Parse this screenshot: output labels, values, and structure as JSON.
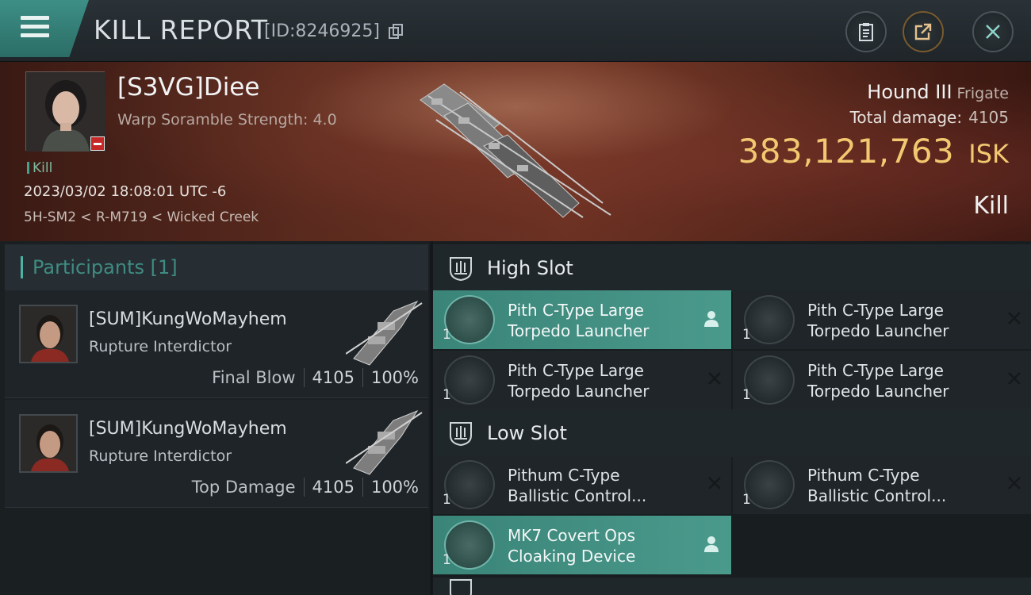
{
  "header": {
    "title": "KILL REPORT",
    "report_id": "[ID:8246925]"
  },
  "victim": {
    "name": "[S3VG]Diee",
    "scramble": "Warp Soramble Strength: 4.0",
    "kill_tag": "Kill",
    "datetime": "2023/03/02 18:08:01 UTC -6",
    "location": "5H-SM2 < R-M719 < Wicked Creek",
    "ship_name": "Hound III",
    "ship_class": "Frigate",
    "total_damage_label": "Total damage:",
    "total_damage": "4105",
    "isk_value": "383,121,763",
    "isk_unit": "ISK",
    "kill_type": "Kill"
  },
  "participants": {
    "title": "Participants [1]",
    "rows": [
      {
        "name": "[SUM]KungWoMayhem",
        "ship": "Rupture Interdictor",
        "label": "Final Blow",
        "damage": "4105",
        "percent": "100%"
      },
      {
        "name": "[SUM]KungWoMayhem",
        "ship": "Rupture Interdictor",
        "label": "Top Damage",
        "damage": "4105",
        "percent": "100%"
      }
    ]
  },
  "slots": {
    "high": {
      "title": "High Slot",
      "modules": [
        {
          "line1": "Pith C-Type Large",
          "line2": "Torpedo Launcher",
          "qty": "1",
          "state": "dropped"
        },
        {
          "line1": "Pith C-Type Large",
          "line2": "Torpedo Launcher",
          "qty": "1",
          "state": "destroyed"
        },
        {
          "line1": "Pith C-Type Large",
          "line2": "Torpedo Launcher",
          "qty": "1",
          "state": "destroyed"
        },
        {
          "line1": "Pith C-Type Large",
          "line2": "Torpedo Launcher",
          "qty": "1",
          "state": "destroyed"
        }
      ]
    },
    "low": {
      "title": "Low Slot",
      "modules": [
        {
          "line1": "Pithum C-Type",
          "line2": "Ballistic Control...",
          "qty": "1",
          "state": "destroyed"
        },
        {
          "line1": "Pithum C-Type",
          "line2": "Ballistic Control...",
          "qty": "1",
          "state": "destroyed"
        },
        {
          "line1": "MK7 Covert Ops",
          "line2": "Cloaking Device",
          "qty": "1",
          "state": "dropped"
        }
      ]
    }
  },
  "colors": {
    "accent": "#3f8c82",
    "isk": "#f2c870",
    "destroyed_badge": "#c62828"
  },
  "icons": [
    "menu-icon",
    "copy-icon",
    "clipboard-icon",
    "share-icon",
    "close-icon",
    "slot-icon",
    "person-icon",
    "x-icon"
  ]
}
